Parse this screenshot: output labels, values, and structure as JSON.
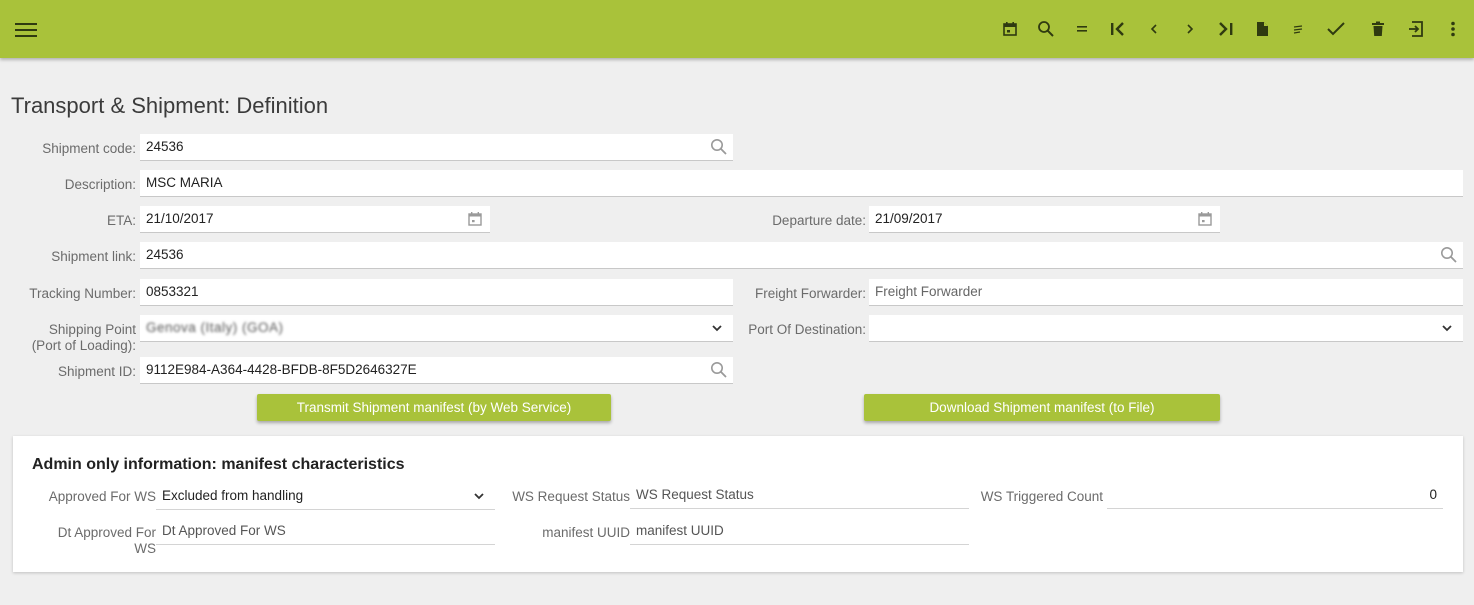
{
  "toolbar": {
    "bg_color": "#a9c23a",
    "menu_icon": "hamburger-menu-icon",
    "buttons": [
      {
        "icon": "calendar-icon"
      },
      {
        "icon": "search-icon"
      },
      {
        "icon": "equals-icon"
      },
      {
        "icon": "first-record-icon"
      },
      {
        "icon": "previous-record-icon"
      },
      {
        "icon": "next-record-icon"
      },
      {
        "icon": "last-record-icon"
      },
      {
        "icon": "new-document-icon"
      },
      {
        "icon": "list-icon"
      },
      {
        "icon": "checkmark-icon"
      },
      {
        "icon": "trash-icon"
      },
      {
        "icon": "exit-icon"
      },
      {
        "icon": "more-vertical-icon"
      }
    ]
  },
  "page": {
    "title": "Transport & Shipment: Definition"
  },
  "form": {
    "shipment_code": {
      "label": "Shipment code:",
      "value": "24536"
    },
    "description": {
      "label": "Description:",
      "value": "MSC MARIA"
    },
    "eta": {
      "label": "ETA:",
      "value": "21/10/2017"
    },
    "departure_date": {
      "label": "Departure date:",
      "value": "21/09/2017"
    },
    "shipment_link": {
      "label": "Shipment link:",
      "value": "24536"
    },
    "tracking_number": {
      "label": "Tracking Number:",
      "value": "0853321"
    },
    "freight_forwarder": {
      "label": "Freight Forwarder:",
      "placeholder": "Freight Forwarder"
    },
    "shipping_point": {
      "label_line1": "Shipping Point",
      "label_line2": "(Port of Loading):",
      "value": "Genova (Italy) (GOA)"
    },
    "port_of_destination": {
      "label": "Port Of Destination:",
      "value": ""
    },
    "shipment_id": {
      "label": "Shipment ID:",
      "value": "9112E984-A364-4428-BFDB-8F5D2646327E"
    },
    "transmit_button": "Transmit Shipment manifest (by Web Service)",
    "download_button": "Download Shipment manifest (to File)"
  },
  "admin": {
    "title": "Admin only information: manifest characteristics",
    "approved_for_ws": {
      "label": "Approved For WS",
      "value": "Excluded from handling"
    },
    "ws_request_status": {
      "label": "WS Request Status",
      "placeholder": "WS Request Status"
    },
    "ws_triggered_count": {
      "label": "WS Triggered Count",
      "value": "0"
    },
    "dt_approved_for_ws": {
      "label_line1": "Dt Approved For",
      "label_line2": "WS",
      "placeholder": "Dt Approved For WS"
    },
    "manifest_uuid": {
      "label": "manifest UUID",
      "placeholder": "manifest UUID"
    }
  }
}
